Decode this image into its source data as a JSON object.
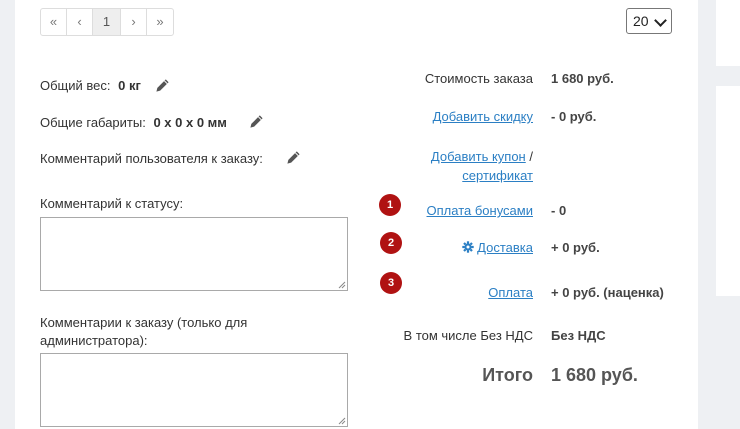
{
  "pagination": {
    "first": "«",
    "prev": "‹",
    "current": "1",
    "next": "›",
    "last": "»"
  },
  "page_size": {
    "selected": "20"
  },
  "left": {
    "weight_label": "Общий вес:",
    "weight_value": "0 кг",
    "dimensions_label": "Общие габариты:",
    "dimensions_value": "0 x 0 x 0 мм",
    "user_comment_label": "Комментарий пользователя к заказу:",
    "status_comment_label": "Комментарий к статусу:",
    "admin_comment_label_line1": "Комментарии к заказу (только для",
    "admin_comment_label_line2": "администратора):"
  },
  "summary": {
    "order_cost_label": "Стоимость заказа",
    "order_cost_value": "1 680 руб.",
    "add_discount": "Добавить скидку",
    "discount_value": "- 0 руб.",
    "add_coupon": "Добавить купон",
    "coupon_sep": "/",
    "certificate": "сертификат",
    "bonus_payment": "Оплата бонусами",
    "bonus_value": "- 0",
    "delivery": "Доставка",
    "delivery_value": "+ 0 руб.",
    "payment": "Оплата",
    "payment_value": "+ 0 руб. (наценка)",
    "vat_label": "В том числе Без НДС",
    "vat_value": "Без НДС",
    "total_label": "Итого",
    "total_value": "1 680 руб."
  },
  "badges": [
    "1",
    "2",
    "3"
  ],
  "colors": {
    "link": "#2b7fc4",
    "badge": "#b01212",
    "panel": "#ffffff",
    "background": "#eef0f3"
  },
  "icons": [
    "pencil-icon",
    "gear-icon"
  ]
}
